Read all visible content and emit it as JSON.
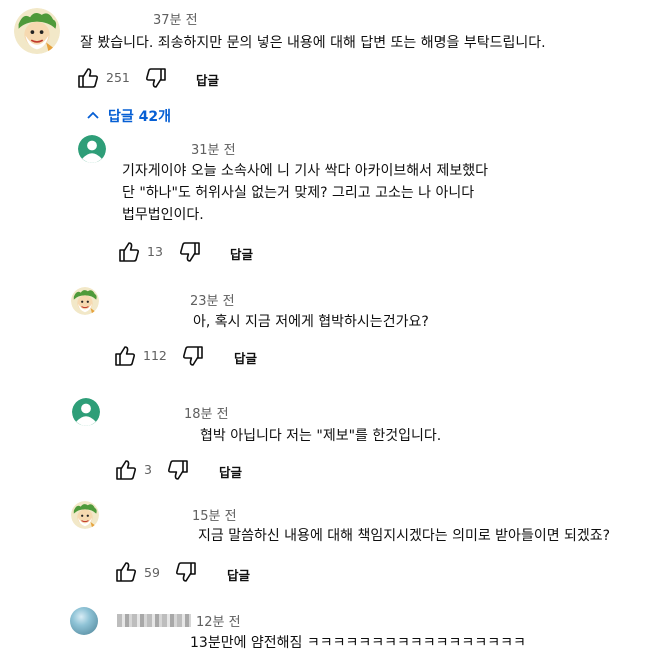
{
  "comment": {
    "time": "37분 전",
    "text": "잘 봤습니다. 죄송하지만 문의 넣은 내용에 대해 답변 또는 해명을 부탁드립니다.",
    "likes": "251",
    "reply_label": "답글"
  },
  "replies_toggle": {
    "label": "답글 42개"
  },
  "replies": [
    {
      "time": "31분 전",
      "lines": [
        "기자게이야 오늘 소속사에 니 기사 싹다 아카이브해서 제보했다",
        "단 \"하나\"도 허위사실 없는거 맞제? 그리고 고소는 나 아니다",
        "법무법인이다."
      ],
      "likes": "13",
      "reply_label": "답글"
    },
    {
      "time": "23분 전",
      "text": "아, 혹시 지금 저에게 협박하시는건가요?",
      "likes": "112",
      "reply_label": "답글"
    },
    {
      "time": "18분 전",
      "text": "협박 아닙니다 저는 \"제보\"를 한것입니다.",
      "likes": "3",
      "reply_label": "답글"
    },
    {
      "time": "15분 전",
      "text": "지금 말씀하신 내용에 대해 책임지시겠다는 의미로 받아들이면 되겠죠?",
      "likes": "59",
      "reply_label": "답글"
    },
    {
      "time": "12분 전",
      "text": "13분만에 얌전해짐 ㅋㅋㅋㅋㅋㅋㅋㅋㅋㅋㅋㅋㅋㅋㅋㅋㅋ"
    }
  ],
  "colors": {
    "link_blue": "#065fd4",
    "secondary_text": "#606060",
    "default_avatar": "#2e9e78"
  },
  "icons": [
    "thumbs-up-icon",
    "thumbs-down-icon",
    "chevron-up-icon",
    "default-avatar-icon",
    "cartoon-avatar-icon"
  ]
}
